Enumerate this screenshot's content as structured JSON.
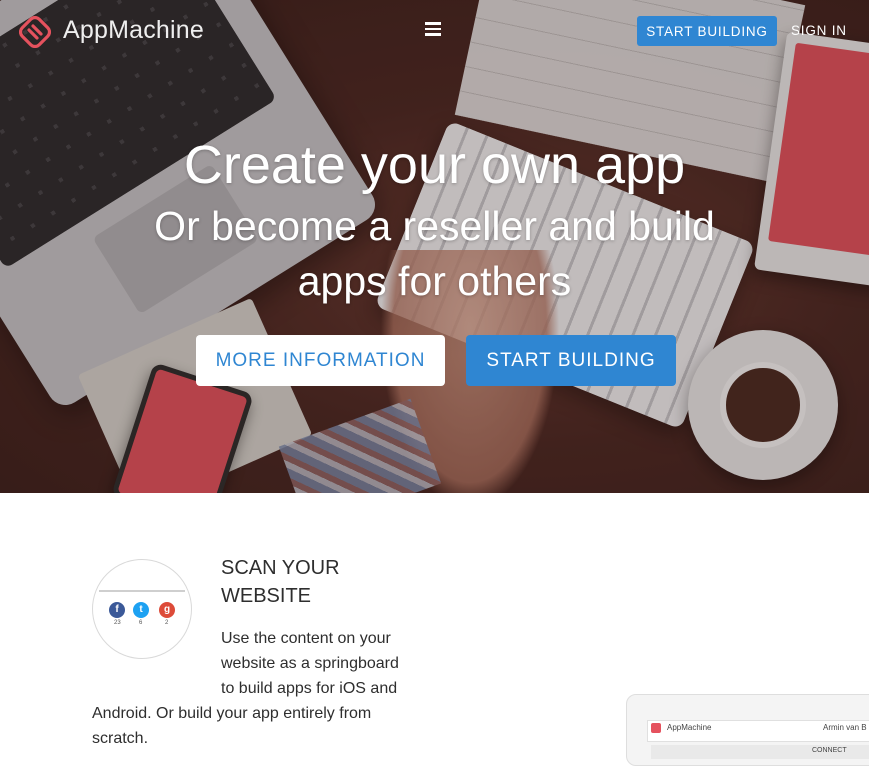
{
  "brand": {
    "name": "AppMachine",
    "logo_color": "#e5525e"
  },
  "nav": {
    "menu_icon": "hamburger-icon",
    "start_building": "START BUILDING",
    "sign_in": "SIGN IN",
    "accent": "#2f86d2"
  },
  "hero": {
    "headline": "Create your own app",
    "subline_1": "Or become a reseller and build",
    "subline_2": "apps for others",
    "more_info": "MORE INFORMATION",
    "start_building": "START BUILDING"
  },
  "feature": {
    "title_line_1": "SCAN YOUR",
    "title_line_2": "WEBSITE",
    "body_lines": [
      "Use the content on your",
      "website as a springboard",
      "to build apps for iOS and",
      "Android. Or build your app entirely from",
      "scratch."
    ],
    "image": {
      "icons": [
        "facebook-icon",
        "twitter-icon",
        "google-plus-icon"
      ],
      "counts": [
        "23",
        "6",
        "2"
      ]
    }
  },
  "device_preview": {
    "brand": "AppMachine",
    "user": "Armin van B",
    "action": "CONNECT"
  }
}
